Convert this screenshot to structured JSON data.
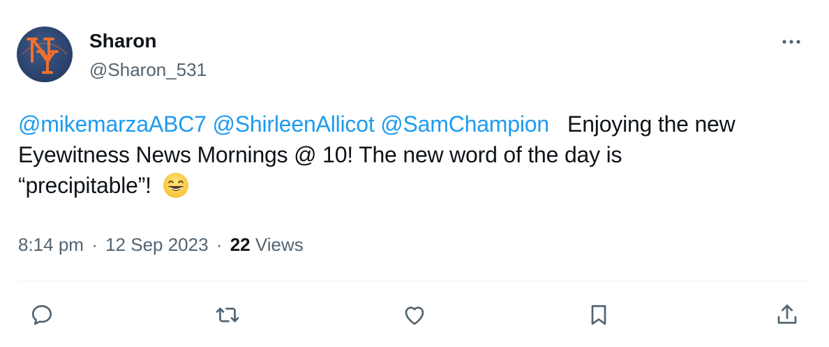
{
  "user": {
    "display_name": "Sharon",
    "handle": "@Sharon_531",
    "avatar_icon": "ny-mets-logo-icon"
  },
  "tweet": {
    "mentions": [
      "@mikemarzaABC7",
      "@ShirleenAllicot",
      "@SamChampion"
    ],
    "text_line1": "Enjoying the new",
    "text_line2": "Eyewitness News Mornings @ 10! The new word of the day is",
    "text_line3": "“precipitable”!",
    "emoji": "grinning-face-with-smiling-eyes"
  },
  "meta": {
    "time": "8:14 pm",
    "separator": "·",
    "date": "12 Sep 2023",
    "views_count": "22",
    "views_label": "Views"
  },
  "icons": {
    "more": "more-horizontal-icon",
    "reply": "reply-icon",
    "retweet": "retweet-icon",
    "like": "heart-icon",
    "bookmark": "bookmark-icon",
    "share": "share-icon"
  },
  "colors": {
    "link": "#1d9bf0",
    "secondary_text": "#536471",
    "primary_text": "#0f1419",
    "divider": "#eff3f4",
    "avatar_bg": "#2d4570",
    "logo_orange": "#f2702c"
  }
}
